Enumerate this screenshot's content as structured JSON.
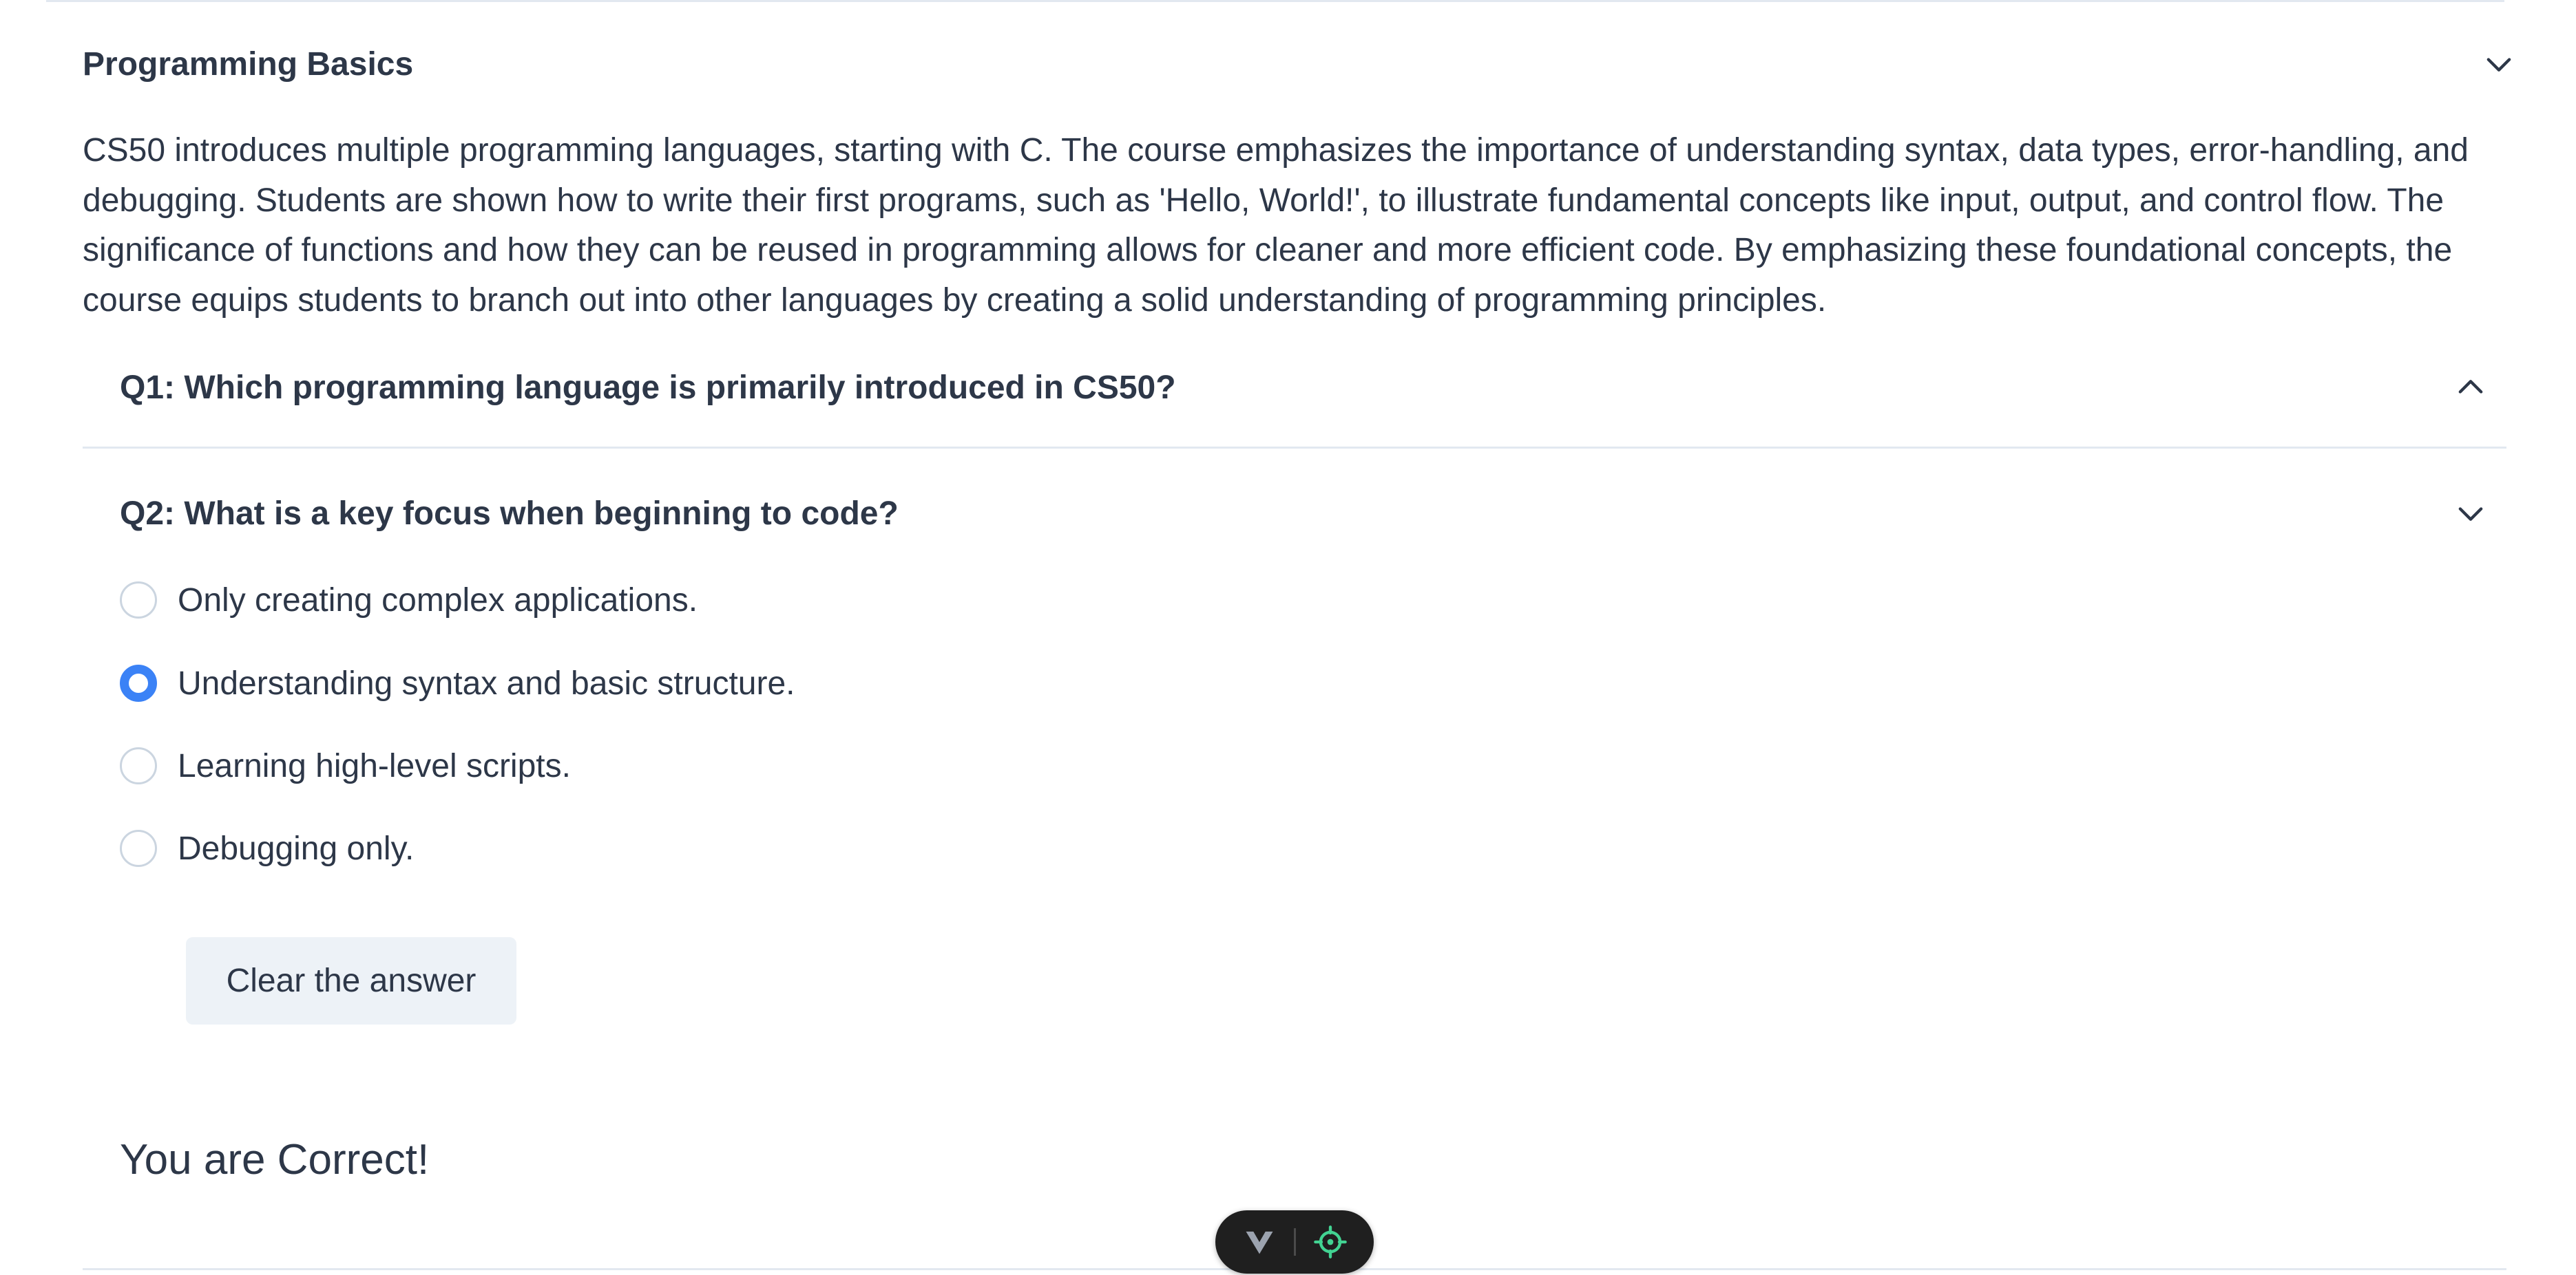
{
  "section": {
    "title": "Programming Basics",
    "description": "CS50 introduces multiple programming languages, starting with C. The course emphasizes the importance of understanding syntax, data types, error-handling, and debugging. Students are shown how to write their first programs, such as 'Hello, World!', to illustrate fundamental concepts like input, output, and control flow. The significance of functions and how they can be reused in programming allows for cleaner and more efficient code. By emphasizing these foundational concepts, the course equips students to branch out into other languages by creating a solid understanding of programming principles.",
    "expanded": true,
    "toggle_icon": "chevron-down-icon"
  },
  "questions": [
    {
      "label": "Q1: Which programming language is primarily introduced in CS50?",
      "expanded": false,
      "toggle_icon": "chevron-up-icon"
    },
    {
      "label": "Q2: What is a key focus when beginning to code?",
      "expanded": true,
      "toggle_icon": "chevron-down-icon",
      "options": [
        "Only creating complex applications.",
        "Understanding syntax and basic structure.",
        "Learning high-level scripts.",
        "Debugging only."
      ],
      "selected_index": 1,
      "clear_label": "Clear the answer",
      "result": "You are Correct!"
    }
  ],
  "devtools": {
    "icons": [
      "vue-logo-icon",
      "target-icon"
    ]
  },
  "colors": {
    "accent": "#3b82f6",
    "text": "#2d3748",
    "border": "#e2e8f0",
    "button_bg": "#edf2f7",
    "devtools_bg": "#1f1f1f",
    "devtools_target": "#42d392"
  }
}
